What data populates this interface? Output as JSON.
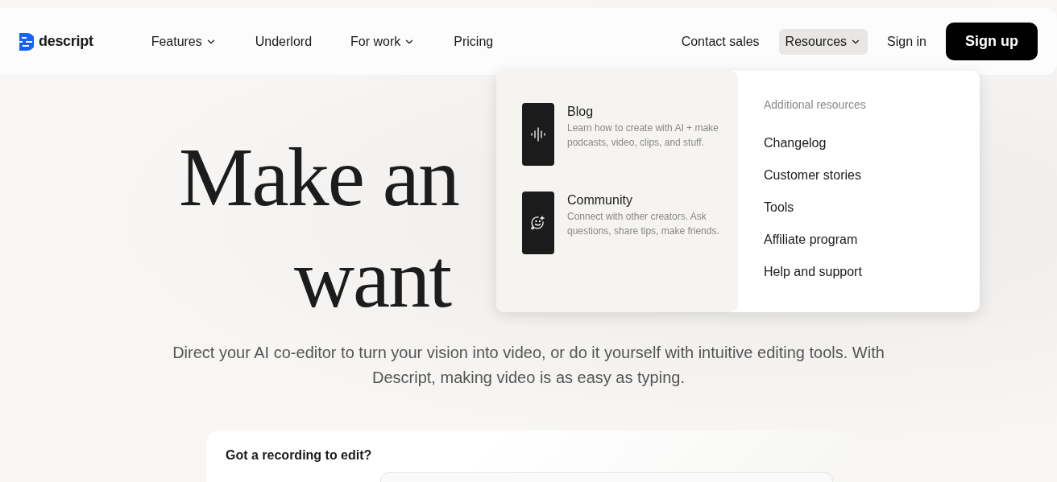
{
  "nav": {
    "logo": "descript",
    "links": [
      {
        "label": "Features",
        "dropdown": true
      },
      {
        "label": "Underlord",
        "dropdown": false
      },
      {
        "label": "For work",
        "dropdown": true
      },
      {
        "label": "Pricing",
        "dropdown": false
      }
    ],
    "right": [
      {
        "label": "Contact sales",
        "kind": "link",
        "dropdown": false,
        "selected": false
      },
      {
        "label": "Resources",
        "kind": "link",
        "dropdown": true,
        "selected": true
      },
      {
        "label": "Sign in",
        "kind": "link",
        "dropdown": false,
        "selected": false
      },
      {
        "label": "Sign up",
        "kind": "button",
        "dropdown": false,
        "selected": false
      }
    ]
  },
  "resources_menu": {
    "featured": [
      {
        "title": "Blog",
        "description": "Learn how to create with AI + make podcasts, video, clips, and stuff."
      },
      {
        "title": "Community",
        "description": "Connect with other creators. Ask questions, share tips, make friends."
      }
    ],
    "additional_heading": "Additional resources",
    "links": [
      "Changelog",
      "Customer stories",
      "Tools",
      "Affiliate program",
      "Help and support"
    ]
  },
  "hero": {
    "headline_lines": [
      "Make an",
      "want"
    ],
    "subtitle": "Direct your AI co-editor to turn your vision into video, or do it yourself with intuitive editing tools. With Descript, making video is as easy as typing."
  },
  "card": {
    "title": "Got a recording to edit?"
  }
}
